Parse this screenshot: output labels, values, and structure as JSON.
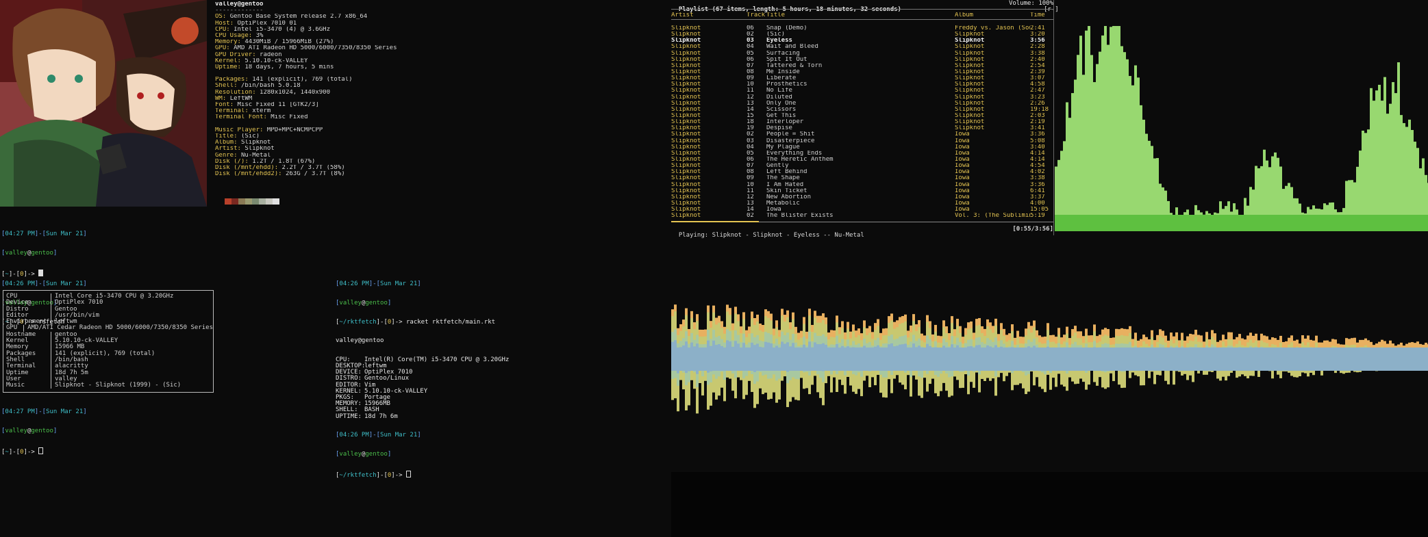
{
  "neofetch": {
    "title": "valley@gentoo",
    "underline": "-------------",
    "info": [
      {
        "k": "OS",
        "v": "Gentoo Base System release 2.7 x86_64"
      },
      {
        "k": "Host",
        "v": "OptiPlex 7010 01"
      },
      {
        "k": "CPU",
        "v": "Intel i5-3470 (4) @ 3.6GHz"
      },
      {
        "k": "CPU Usage",
        "v": "3%"
      },
      {
        "k": "Memory",
        "v": "4430MiB / 15966MiB (27%)"
      },
      {
        "k": "GPU",
        "v": "AMD ATI Radeon HD 5000/6000/7350/8350 Series"
      },
      {
        "k": "GPU Driver",
        "v": "radeon"
      },
      {
        "k": "Kernel",
        "v": "5.10.10-ck-VALLEY"
      },
      {
        "k": "Uptime",
        "v": "18 days, 7 hours, 5 mins"
      },
      {
        "k": "",
        "v": ""
      },
      {
        "k": "Packages",
        "v": "141 (explicit), 769 (total)"
      },
      {
        "k": "Shell",
        "v": "/bin/bash 5.0.18"
      },
      {
        "k": "Resolution",
        "v": "1280x1024, 1440x900"
      },
      {
        "k": "WM",
        "v": "LeftWM"
      },
      {
        "k": "Font",
        "v": "Misc Fixed 11 [GTK2/3]"
      },
      {
        "k": "Terminal",
        "v": "xterm"
      },
      {
        "k": "Terminal Font",
        "v": "Misc Fixed"
      },
      {
        "k": "",
        "v": ""
      },
      {
        "k": "Music Player",
        "v": "MPD+MPC+NCMPCPP"
      },
      {
        "k": "Title",
        "v": "(Sic)"
      },
      {
        "k": "Album",
        "v": "Slipknot"
      },
      {
        "k": "Artist",
        "v": "Slipknot"
      },
      {
        "k": "Genre",
        "v": "Nu-Metal"
      },
      {
        "k": "Disk (/)",
        "v": "1.2T / 1.8T (67%)"
      },
      {
        "k": "Disk (/mnt/ehdd)",
        "v": "2.2T / 3.7T (58%)"
      },
      {
        "k": "Disk (/mnt/ehdd2)",
        "v": "263G / 3.7T (8%)"
      }
    ],
    "swatch_colors": [
      "#b8402a",
      "#7a2820",
      "#8a7a55",
      "#9a9a70",
      "#7a8a70",
      "#a8b0a0",
      "#c8c8c0",
      "#e0e0e0"
    ]
  },
  "term1": {
    "time": "04:27 PM",
    "date": "Sun Mar 21",
    "user": "valley",
    "host": "gentoo",
    "cwd": "~",
    "status": "0"
  },
  "term2": {
    "time": "04:26 PM",
    "date": "Sun Mar 21",
    "user": "valley",
    "host": "gentoo",
    "cwd": "~",
    "status": "0",
    "command": "rsfetch",
    "rows": [
      {
        "k": "CPU",
        "v": "Intel Core i5-3470 CPU @ 3.20GHz"
      },
      {
        "k": "Device",
        "v": "OptiPlex 7010"
      },
      {
        "k": "Distro",
        "v": "Gentoo"
      },
      {
        "k": "Editor",
        "v": "/usr/bin/vim"
      },
      {
        "k": "Environment",
        "v": "leftwm"
      },
      {
        "k": "GPU",
        "v": "AMD/ATI Cedar Radeon HD 5000/6000/7350/8350 Series"
      },
      {
        "k": "Hostname",
        "v": "gentoo"
      },
      {
        "k": "Kernel",
        "v": "5.10.10-ck-VALLEY"
      },
      {
        "k": "Memory",
        "v": "15966 MB"
      },
      {
        "k": "Packages",
        "v": "141 (explicit), 769 (total)"
      },
      {
        "k": "Shell",
        "v": "/bin/bash"
      },
      {
        "k": "Terminal",
        "v": "alacritty"
      },
      {
        "k": "Uptime",
        "v": "18d 7h 5m"
      },
      {
        "k": "User",
        "v": "valley"
      },
      {
        "k": "Music",
        "v": "Slipknot - Slipknot (1999) - (Sic)"
      }
    ],
    "after_time": "04:27 PM",
    "after_date": "Sun Mar 21"
  },
  "term3": {
    "time": "04:26 PM",
    "date": "Sun Mar 21",
    "user": "valley",
    "host": "gentoo",
    "cwd": "~/rktfetch",
    "status": "0",
    "command": "racket rktfetch/main.rkt",
    "header": "valley@gentoo",
    "rows": [
      {
        "k": "CPU",
        "v": "Intel(R) Core(TM) i5-3470 CPU @ 3.20GHz"
      },
      {
        "k": "DESKTOP",
        "v": "leftwm"
      },
      {
        "k": "DEVICE",
        "v": "OptiPlex 7010"
      },
      {
        "k": "DISTRO",
        "v": "Gentoo/Linux"
      },
      {
        "k": "EDITOR",
        "v": "Vim"
      },
      {
        "k": "KERNEL",
        "v": "5.10.10-ck-VALLEY"
      },
      {
        "k": "PKGS",
        "v": "Portage"
      },
      {
        "k": "MEMORY",
        "v": "15966MB"
      },
      {
        "k": "SHELL",
        "v": "BASH"
      },
      {
        "k": "UPTIME",
        "v": "18d 7h 6m"
      }
    ],
    "after_time": "04:26 PM",
    "after_date": "Sun Mar 21",
    "after_cwd": "~/rktfetch"
  },
  "playlist": {
    "header_left": "Playlist (67 items, length: 5 hours, 18 minutes, 32 seconds)",
    "volume": "Volume: 100%",
    "flags": "[r-]",
    "cols": {
      "artist": "Artist",
      "track": "Track",
      "title": "Title",
      "album": "Album",
      "time": "Time"
    },
    "rows": [
      [
        "Slipknot",
        "06",
        "Snap (Demo)",
        "Freddy vs. Jason (Sound",
        "2:41"
      ],
      [
        "Slipknot",
        "02",
        "(Sic)",
        "Slipknot",
        "3:20"
      ],
      [
        "Slipknot",
        "03",
        "Eyeless",
        "Slipknot",
        "3:56"
      ],
      [
        "Slipknot",
        "04",
        "Wait and Bleed",
        "Slipknot",
        "2:28"
      ],
      [
        "Slipknot",
        "05",
        "Surfacing",
        "Slipknot",
        "3:38"
      ],
      [
        "Slipknot",
        "06",
        "Spit It Out",
        "Slipknot",
        "2:40"
      ],
      [
        "Slipknot",
        "07",
        "Tattered & Torn",
        "Slipknot",
        "2:54"
      ],
      [
        "Slipknot",
        "08",
        "Me Inside",
        "Slipknot",
        "2:39"
      ],
      [
        "Slipknot",
        "09",
        "Liberate",
        "Slipknot",
        "3:07"
      ],
      [
        "Slipknot",
        "10",
        "Prosthetics",
        "Slipknot",
        "4:58"
      ],
      [
        "Slipknot",
        "11",
        "No Life",
        "Slipknot",
        "2:47"
      ],
      [
        "Slipknot",
        "12",
        "Diluted",
        "Slipknot",
        "3:23"
      ],
      [
        "Slipknot",
        "13",
        "Only One",
        "Slipknot",
        "2:26"
      ],
      [
        "Slipknot",
        "14",
        "Scissors",
        "Slipknot",
        "19:18"
      ],
      [
        "Slipknot",
        "15",
        "Get This",
        "Slipknot",
        "2:03"
      ],
      [
        "Slipknot",
        "18",
        "Interloper",
        "Slipknot",
        "2:19"
      ],
      [
        "Slipknot",
        "19",
        "Despise",
        "Slipknot",
        "3:41"
      ],
      [
        "Slipknot",
        "02",
        "People = Shit",
        "Iowa",
        "3:36"
      ],
      [
        "Slipknot",
        "03",
        "Disasterpiece",
        "Iowa",
        "5:08"
      ],
      [
        "Slipknot",
        "04",
        "My Plague",
        "Iowa",
        "3:40"
      ],
      [
        "Slipknot",
        "05",
        "Everything Ends",
        "Iowa",
        "4:14"
      ],
      [
        "Slipknot",
        "06",
        "The Heretic Anthem",
        "Iowa",
        "4:14"
      ],
      [
        "Slipknot",
        "07",
        "Gently",
        "Iowa",
        "4:54"
      ],
      [
        "Slipknot",
        "08",
        "Left Behind",
        "Iowa",
        "4:02"
      ],
      [
        "Slipknot",
        "09",
        "The Shape",
        "Iowa",
        "3:38"
      ],
      [
        "Slipknot",
        "10",
        "I Am Hated",
        "Iowa",
        "3:36"
      ],
      [
        "Slipknot",
        "11",
        "Skin Ticket",
        "Iowa",
        "6:41"
      ],
      [
        "Slipknot",
        "12",
        "New Abortion",
        "Iowa",
        "3:37"
      ],
      [
        "Slipknot",
        "13",
        "Metabolic",
        "Iowa",
        "4:00"
      ],
      [
        "Slipknot",
        "14",
        "Iowa",
        "Iowa",
        "15:05"
      ],
      [
        "Slipknot",
        "02",
        "The Blister Exists",
        "Vol. 3: (The Subliminal",
        "5:19"
      ]
    ],
    "current_index": 2,
    "progress": 0.23,
    "status_left": "Playing: Slipknot - Slipknot - Eyeless -- Nu-Metal",
    "status_right": "[0:55/3:56]",
    "colors": {
      "artist": "#e4c452",
      "vis_light": "#98d870",
      "vis_dark": "#5ec040"
    }
  },
  "visualizer": {
    "colors": [
      "#e8b060",
      "#c8c870",
      "#a8c8a0",
      "#8cb0c8",
      "#9a80c8"
    ]
  }
}
